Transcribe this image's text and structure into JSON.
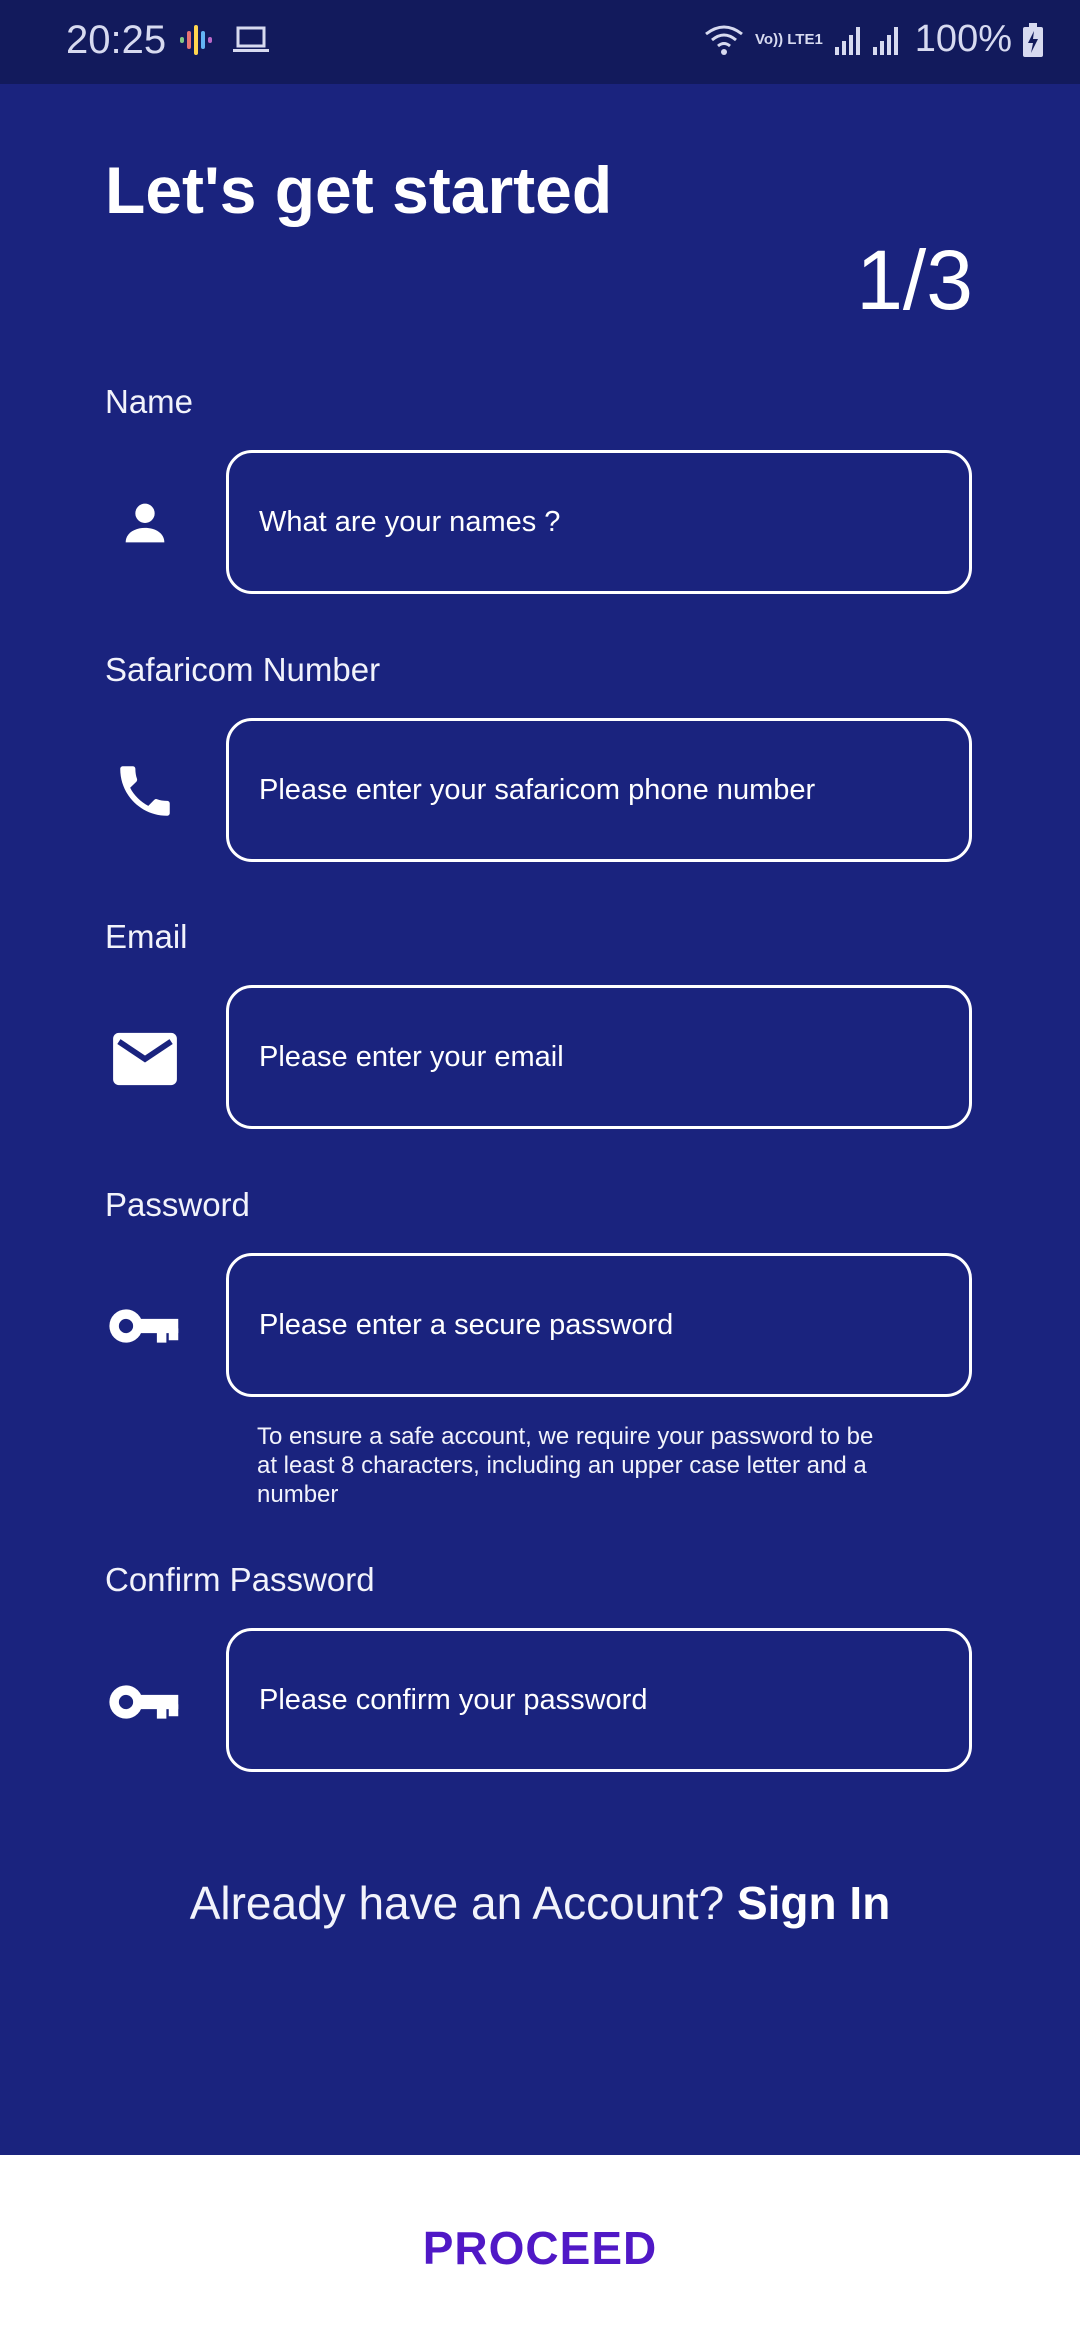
{
  "status_bar": {
    "time": "20:25",
    "battery": "100%",
    "network_label": "Vo)) LTE1",
    "icons": [
      "voice-assistant-icon",
      "laptop-icon",
      "wifi-icon",
      "signal-icon",
      "battery-charging-icon"
    ]
  },
  "header": {
    "title": "Let's get started",
    "step": "1/3"
  },
  "form": {
    "name": {
      "label": "Name",
      "placeholder": "What are your names ?",
      "icon": "person-icon"
    },
    "phone": {
      "label": "Safaricom Number",
      "placeholder": "Please enter your safaricom phone number",
      "icon": "phone-icon"
    },
    "email": {
      "label": "Email",
      "placeholder": "Please enter your email",
      "icon": "mail-icon"
    },
    "password": {
      "label": "Password",
      "placeholder": "Please enter a secure password",
      "icon": "key-icon"
    },
    "password_hint": "To ensure a safe account, we require your password to be at least 8 characters, including an upper case letter and a number",
    "confirm": {
      "label": "Confirm Password",
      "placeholder": "Please confirm your password",
      "icon": "key-icon"
    }
  },
  "signin": {
    "prompt": "Already have an Account?",
    "link": "Sign In"
  },
  "footer": {
    "proceed_label": "PROCEED"
  },
  "colors": {
    "background": "#1a237e",
    "status_bar": "#121a5c",
    "accent": "#5018c6",
    "footer_bg": "#ffffff"
  }
}
